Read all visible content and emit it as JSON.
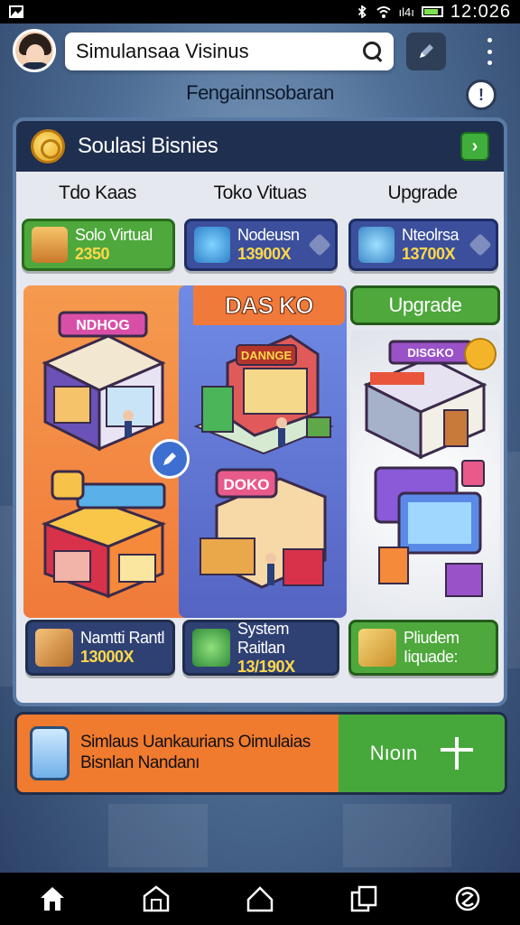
{
  "status_bar": {
    "time": "12:026",
    "signal_text": "ıl4ı"
  },
  "header": {
    "search_value": "Simulansaa Visinus",
    "subtitle": "Fengainnsobaran"
  },
  "panel": {
    "title": "Soulasi Bisnies",
    "column_labels": [
      "Tdo Kaas",
      "Toko Vituas",
      "Upgrade"
    ],
    "top_cards": [
      {
        "line1": "Solo Virtual",
        "line2": "2350"
      },
      {
        "line1": "Nodeusn",
        "line2": "13900X"
      },
      {
        "line1": "Nteolrsa",
        "line2": "13700X"
      }
    ],
    "dasko_tab": "DAS KO",
    "upgrade_button": "Upgrade",
    "shop_signs": [
      "NDHOG",
      "DANNGE",
      "DOKO",
      "DISGKO"
    ],
    "bottom_cards": [
      {
        "line1": "Namtti Rantl",
        "line2": "13000X"
      },
      {
        "line1": "System Raitlan",
        "line2": "13/190X"
      },
      {
        "line1": "Pliudem",
        "line2": "Iiquade:"
      }
    ]
  },
  "sim_banner": {
    "text_line1": "Simlaus Uankaurians Oimulaias",
    "text_line2": "Bisnlan Nandanı",
    "action_label": "Nıoın"
  },
  "colors": {
    "panel_header": "#1f2f4f",
    "green": "#4ea83c",
    "orange": "#f07a3a",
    "blue": "#5564c2"
  },
  "icons": {
    "nav": [
      "home-icon",
      "store-icon",
      "house-outline-icon",
      "copy-icon",
      "settings-swirl-icon"
    ]
  }
}
